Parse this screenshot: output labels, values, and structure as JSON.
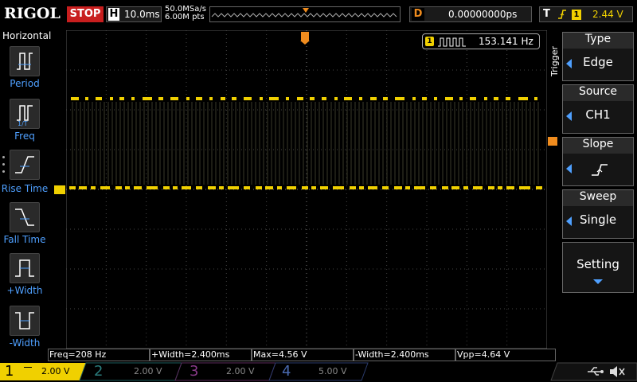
{
  "brand": "RIGOL",
  "run_state": "STOP",
  "horizontal": {
    "label": "H",
    "timebase": "10.0ms",
    "sample_rate": "50.0MSa/s",
    "mem_depth": "6.00M pts"
  },
  "delay": {
    "label": "D",
    "value": "0.00000000ps"
  },
  "trigger_status": {
    "label": "T",
    "channel": "1",
    "level": "2.44 V"
  },
  "left_menu": {
    "title": "Horizontal",
    "items": [
      {
        "label": "Period",
        "icon": "period-icon"
      },
      {
        "label": "Freq",
        "icon": "freq-icon"
      },
      {
        "label": "Rise Time",
        "icon": "rise-time-icon"
      },
      {
        "label": "Fall Time",
        "icon": "fall-time-icon"
      },
      {
        "label": "+Width",
        "icon": "pos-width-icon"
      },
      {
        "label": "-Width",
        "icon": "neg-width-icon"
      }
    ]
  },
  "freq_counter": {
    "channel": "1",
    "value": "153.141 Hz"
  },
  "trigger_menu": {
    "title": "Trigger",
    "items": [
      {
        "title": "Type",
        "value": "Edge"
      },
      {
        "title": "Source",
        "value": "CH1"
      },
      {
        "title": "Slope",
        "value": ""
      },
      {
        "title": "Sweep",
        "value": "Single"
      },
      {
        "title": "Setting",
        "value": ""
      }
    ]
  },
  "markers": {
    "ch1": "1",
    "trigger_pos": "T",
    "trigger_level": "T"
  },
  "measurements": [
    "Freq=208 Hz",
    "+Width=2.400ms",
    "Max=4.56 V",
    "-Width=2.400ms",
    "Vpp=4.64 V"
  ],
  "channels": [
    {
      "num": "1",
      "scale": "2.00 V",
      "color": "#f0d000"
    },
    {
      "num": "2",
      "scale": "2.00 V",
      "color": "#1c8c8c"
    },
    {
      "num": "3",
      "scale": "2.00 V",
      "color": "#b030b0"
    },
    {
      "num": "4",
      "scale": "5.00 V",
      "color": "#3a6ad0"
    }
  ],
  "colors": {
    "ch1": "#f0d000",
    "accent": "#4fa0ff",
    "trigger": "#f08c1e",
    "stop": "#c81e1e"
  }
}
